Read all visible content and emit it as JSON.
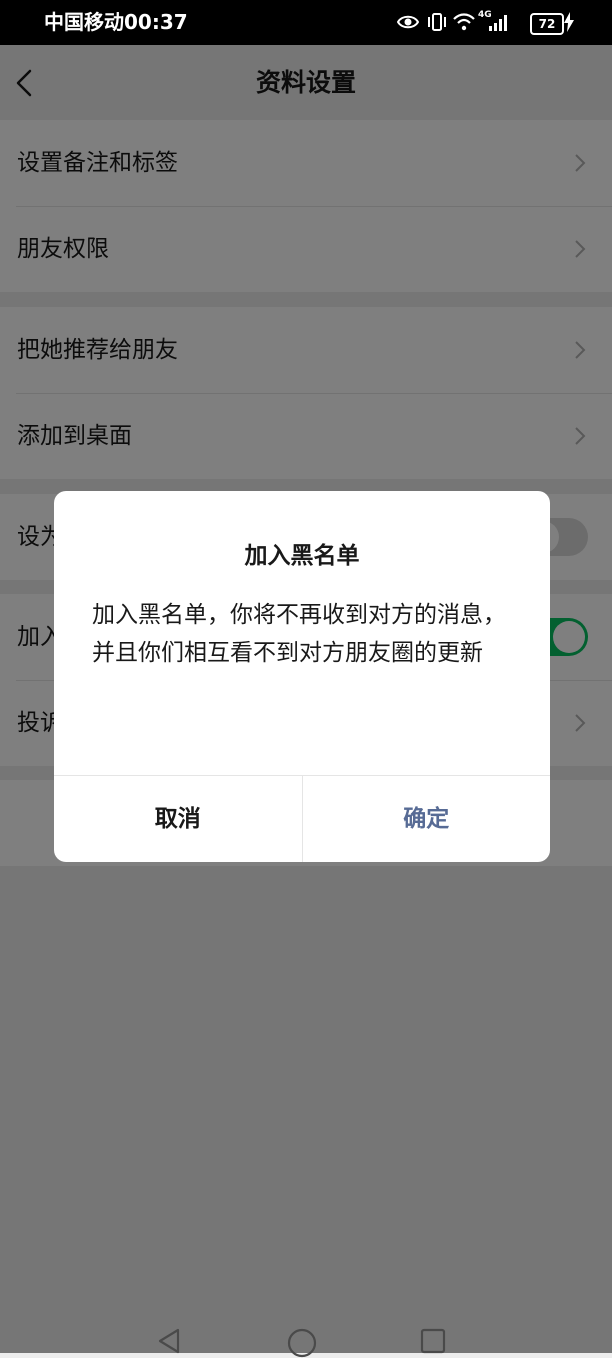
{
  "status_bar": {
    "carrier_time": "中国移动00:37",
    "network": "4G",
    "battery": "72",
    "icons": [
      "eye-icon",
      "vibrate-icon",
      "wifi-icon",
      "signal-icon",
      "battery-icon",
      "charging-icon"
    ]
  },
  "nav": {
    "title": "资料设置",
    "back_icon": "chevron-left-icon"
  },
  "settings": {
    "group1": [
      {
        "label": "设置备注和标签",
        "accessory": "chevron"
      },
      {
        "label": "朋友权限",
        "accessory": "chevron"
      }
    ],
    "group2": [
      {
        "label": "把她推荐给朋友",
        "accessory": "chevron"
      },
      {
        "label": "添加到桌面",
        "accessory": "chevron"
      }
    ],
    "group3": [
      {
        "label": "设为星标朋友",
        "accessory": "toggle",
        "on": false
      }
    ],
    "group4": [
      {
        "label": "加入黑名单",
        "accessory": "toggle",
        "on": true
      },
      {
        "label": "投诉",
        "accessory": "chevron"
      }
    ]
  },
  "dialog": {
    "title": "加入黑名单",
    "message": "加入黑名单，你将不再收到对方的消息，并且你们相互看不到对方朋友圈的更新",
    "cancel_label": "取消",
    "confirm_label": "确定"
  },
  "colors": {
    "accent_green": "#07c160",
    "confirm_blue": "#576b95",
    "background": "#ededed"
  }
}
